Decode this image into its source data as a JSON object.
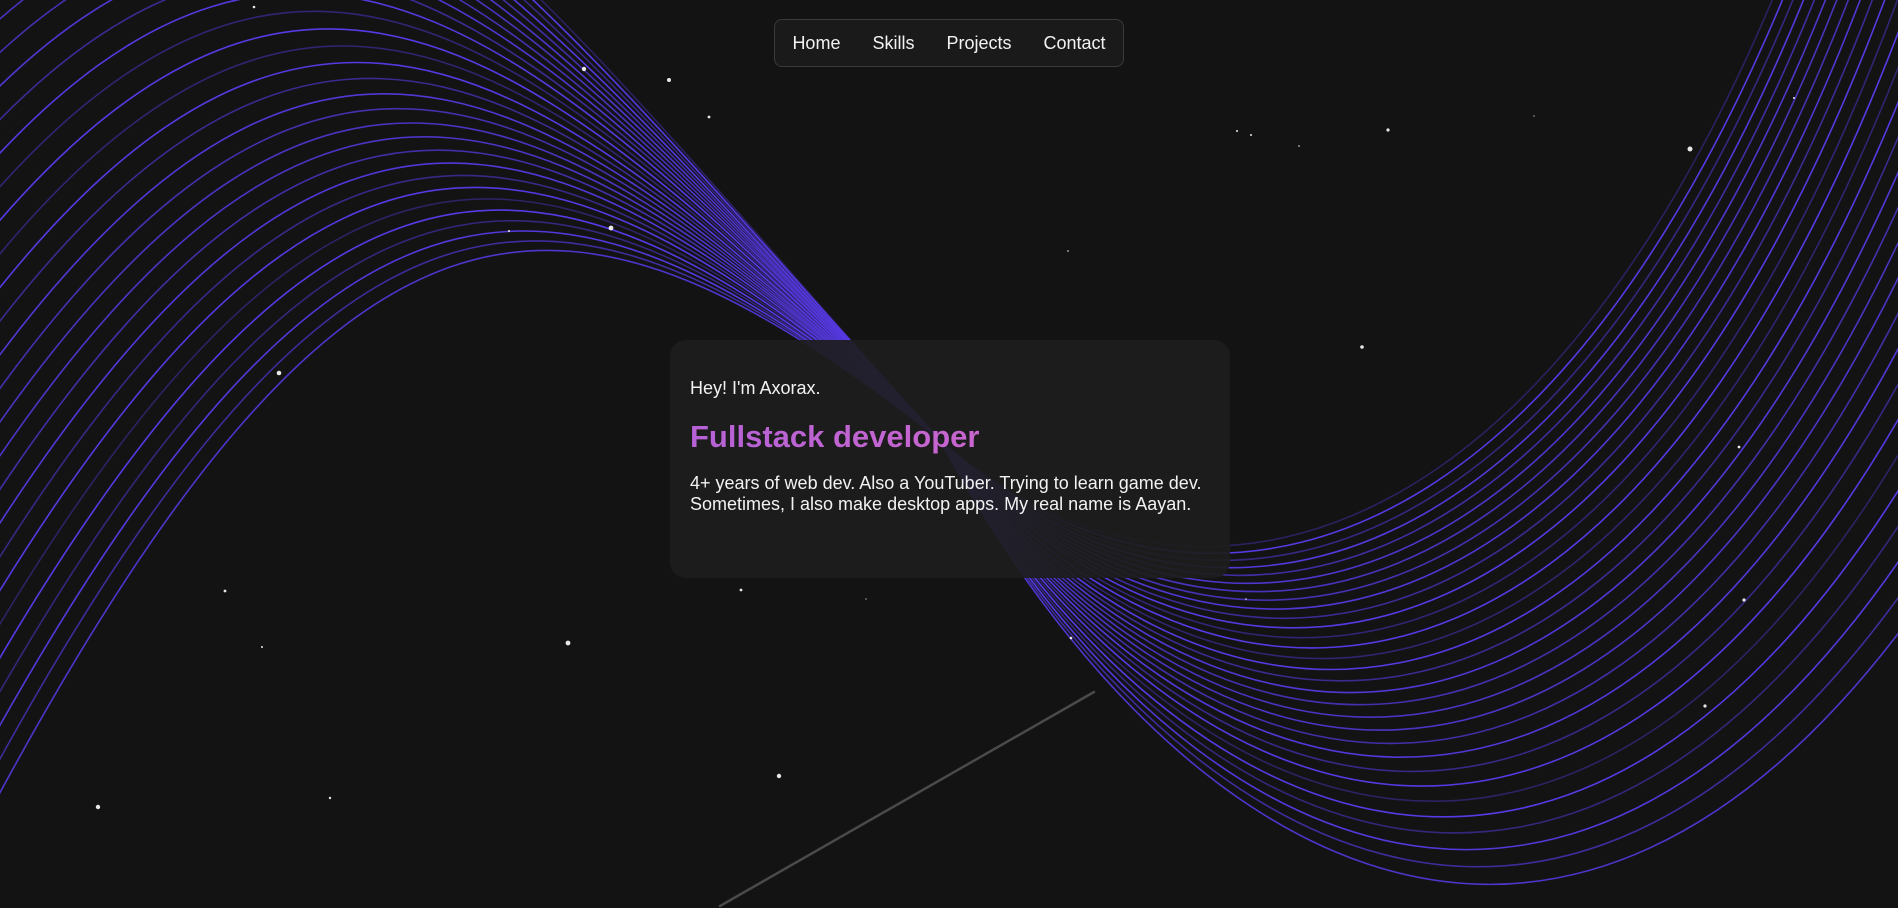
{
  "nav": {
    "items": [
      {
        "label": "Home"
      },
      {
        "label": "Skills"
      },
      {
        "label": "Projects"
      },
      {
        "label": "Contact"
      }
    ]
  },
  "hero": {
    "greeting": "Hey! I'm Axorax.",
    "role": "Fullstack developer",
    "bio": "4+ years of web dev. Also a YouTuber. Trying to learn game dev. Sometimes, I also make desktop apps. My real name is Aayan."
  },
  "theme": {
    "background": "#131313",
    "wave_color": "#5b3cf0",
    "accent_gradient_start": "#b562d6",
    "accent_gradient_end": "#d868c8",
    "star_color": "#ffffff"
  }
}
